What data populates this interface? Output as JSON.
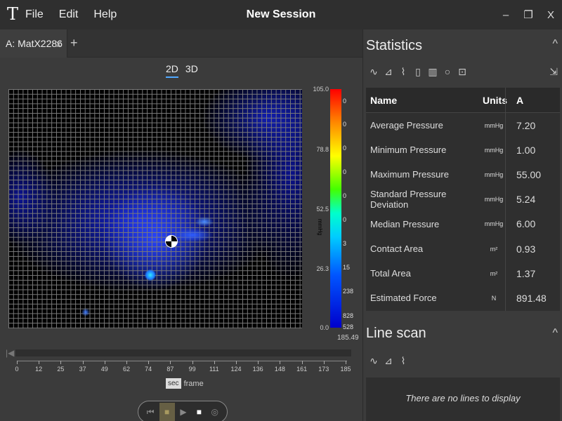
{
  "app": {
    "logo": "T",
    "title": "New Session"
  },
  "menu": {
    "items": [
      "File",
      "Edit",
      "Help"
    ]
  },
  "window_controls": {
    "minimize": "–",
    "restore": "❐",
    "close": "X"
  },
  "tab": {
    "label": "A: MatX2286",
    "close": "x",
    "add": "+"
  },
  "view": {
    "option_2d": "2D",
    "option_3d": "3D",
    "selected": "2D"
  },
  "heatmap": {
    "scale_ticks": [
      "105.0",
      "78.8",
      "52.5",
      "26.3",
      "0.0"
    ],
    "scale_values": [
      "0",
      "0",
      "0",
      "0",
      "0",
      "0",
      "3",
      "15",
      "238",
      "828",
      "528"
    ],
    "scale_title": "mmHg",
    "scale_max": "185.49"
  },
  "timeline": {
    "skip_icon": "|◀",
    "ticks": [
      "0",
      "12",
      "25",
      "37",
      "49",
      "62",
      "74",
      "87",
      "99",
      "111",
      "124",
      "136",
      "148",
      "161",
      "173",
      "185"
    ],
    "unit_sec": "sec",
    "unit_frame": "frame"
  },
  "player": {
    "first": "⏮",
    "current": "■",
    "play": "▶",
    "stop": "■",
    "record": "◎"
  },
  "statistics": {
    "title": "Statistics",
    "collapse": "^",
    "tools": [
      "∿",
      "⊿",
      "⌇",
      "▯",
      "▥",
      "○",
      "⊡"
    ],
    "tool_right": "⇲",
    "headers": {
      "name": "Name",
      "units": "Units",
      "a": "A"
    },
    "rows": [
      {
        "name": "Average Pressure",
        "unit": "mmHg",
        "value": "7.20"
      },
      {
        "name": "Minimum Pressure",
        "unit": "mmHg",
        "value": "1.00"
      },
      {
        "name": "Maximum Pressure",
        "unit": "mmHg",
        "value": "55.00"
      },
      {
        "name": "Standard Pressure Deviation",
        "unit": "mmHg",
        "value": "5.24"
      },
      {
        "name": "Median Pressure",
        "unit": "mmHg",
        "value": "6.00"
      },
      {
        "name": "Contact Area",
        "unit": "m²",
        "value": "0.93"
      },
      {
        "name": "Total Area",
        "unit": "m²",
        "value": "1.37"
      },
      {
        "name": "Estimated Force",
        "unit": "N",
        "value": "891.48"
      }
    ]
  },
  "line_scan": {
    "title": "Line scan",
    "collapse": "^",
    "tools": [
      "∿",
      "⊿",
      "⌇"
    ],
    "empty": "There are no lines to display"
  }
}
